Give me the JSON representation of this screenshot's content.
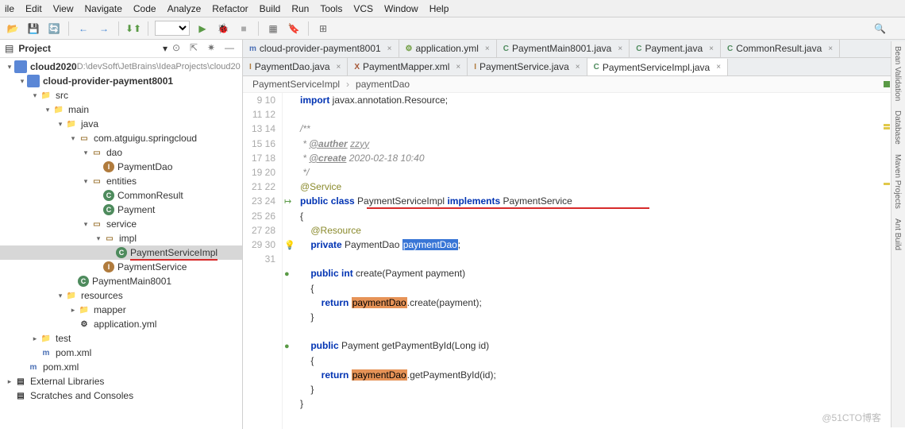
{
  "menu": [
    "ile",
    "Edit",
    "View",
    "Navigate",
    "Code",
    "Analyze",
    "Refactor",
    "Build",
    "Run",
    "Tools",
    "VCS",
    "Window",
    "Help"
  ],
  "project_tool": {
    "title": "Project"
  },
  "tree": [
    {
      "depth": 0,
      "arrow": "▾",
      "iconType": "module",
      "iconChar": "",
      "label": "cloud2020",
      "bold": true,
      "suffix": " D:\\devSoft\\JetBrains\\IdeaProjects\\cloud20"
    },
    {
      "depth": 1,
      "arrow": "▾",
      "iconType": "module",
      "iconChar": "",
      "label": "cloud-provider-payment8001",
      "bold": true
    },
    {
      "depth": 2,
      "arrow": "▾",
      "iconType": "folder",
      "iconChar": "📁",
      "label": "src"
    },
    {
      "depth": 3,
      "arrow": "▾",
      "iconType": "folder",
      "iconChar": "📁",
      "label": "main"
    },
    {
      "depth": 4,
      "arrow": "▾",
      "iconType": "folder",
      "iconChar": "📁",
      "label": "java"
    },
    {
      "depth": 5,
      "arrow": "▾",
      "iconType": "pkg",
      "iconChar": "▭",
      "label": "com.atguigu.springcloud"
    },
    {
      "depth": 6,
      "arrow": "▾",
      "iconType": "pkg",
      "iconChar": "▭",
      "label": "dao"
    },
    {
      "depth": 7,
      "arrow": "",
      "iconType": "class-i",
      "iconChar": "I",
      "label": "PaymentDao"
    },
    {
      "depth": 6,
      "arrow": "▾",
      "iconType": "pkg",
      "iconChar": "▭",
      "label": "entities"
    },
    {
      "depth": 7,
      "arrow": "",
      "iconType": "class-c",
      "iconChar": "C",
      "label": "CommonResult"
    },
    {
      "depth": 7,
      "arrow": "",
      "iconType": "class-c",
      "iconChar": "C",
      "label": "Payment"
    },
    {
      "depth": 6,
      "arrow": "▾",
      "iconType": "pkg",
      "iconChar": "▭",
      "label": "service"
    },
    {
      "depth": 7,
      "arrow": "▾",
      "iconType": "pkg",
      "iconChar": "▭",
      "label": "impl"
    },
    {
      "depth": 8,
      "arrow": "",
      "iconType": "class-c",
      "iconChar": "C",
      "label": "PaymentServiceImpl",
      "selected": true,
      "redUnder": true
    },
    {
      "depth": 7,
      "arrow": "",
      "iconType": "class-i",
      "iconChar": "I",
      "label": "PaymentService"
    },
    {
      "depth": 5,
      "arrow": "",
      "iconType": "class-c",
      "iconChar": "C",
      "label": "PaymentMain8001"
    },
    {
      "depth": 4,
      "arrow": "▾",
      "iconType": "folder",
      "iconChar": "📁",
      "label": "resources"
    },
    {
      "depth": 5,
      "arrow": "▸",
      "iconType": "folder",
      "iconChar": "📁",
      "label": "mapper"
    },
    {
      "depth": 5,
      "arrow": "",
      "iconType": "file",
      "iconChar": "⚙",
      "label": "application.yml"
    },
    {
      "depth": 2,
      "arrow": "▸",
      "iconType": "folder",
      "iconChar": "📁",
      "label": "test"
    },
    {
      "depth": 2,
      "arrow": "",
      "iconType": "maven",
      "iconChar": "m",
      "label": "pom.xml"
    },
    {
      "depth": 1,
      "arrow": "",
      "iconType": "maven",
      "iconChar": "m",
      "label": "pom.xml"
    },
    {
      "depth": 0,
      "arrow": "▸",
      "iconType": "lib",
      "iconChar": "▤",
      "label": "External Libraries"
    },
    {
      "depth": 0,
      "arrow": "",
      "iconType": "scratch",
      "iconChar": "▤",
      "label": "Scratches and Consoles"
    }
  ],
  "tabs_row1": [
    {
      "label": "cloud-provider-payment8001",
      "icon": "m",
      "color": "#4a6fb5"
    },
    {
      "label": "application.yml",
      "icon": "⚙",
      "color": "#6a9a3a"
    },
    {
      "label": "PaymentMain8001.java",
      "icon": "C",
      "color": "#4e8b5d"
    },
    {
      "label": "Payment.java",
      "icon": "C",
      "color": "#4e8b5d"
    },
    {
      "label": "CommonResult.java",
      "icon": "C",
      "color": "#4e8b5d"
    }
  ],
  "tabs_row2": [
    {
      "label": "PaymentDao.java",
      "icon": "I",
      "color": "#b07b3d"
    },
    {
      "label": "PaymentMapper.xml",
      "icon": "X",
      "color": "#a55636"
    },
    {
      "label": "PaymentService.java",
      "icon": "I",
      "color": "#b07b3d"
    },
    {
      "label": "PaymentServiceImpl.java",
      "icon": "C",
      "color": "#4e8b5d",
      "active": true
    }
  ],
  "breadcrumb": [
    "PaymentServiceImpl",
    "paymentDao"
  ],
  "code": {
    "lines": [
      {
        "n": 9,
        "html": "<span class='kw'>import</span> javax.annotation.Resource;"
      },
      {
        "n": 10,
        "html": ""
      },
      {
        "n": 11,
        "html": "<span class='cmt'>/**</span>"
      },
      {
        "n": 12,
        "html": "<span class='cmt'> * </span><span class='doc-tag'>@auther</span><span class='cmt'> </span><span class='cmt' style='text-decoration:underline'>zzyy</span>"
      },
      {
        "n": 13,
        "html": "<span class='cmt'> * </span><span class='doc-tag'>@create</span><span class='cmt'> 2020-02-18 10:40</span>"
      },
      {
        "n": 14,
        "html": "<span class='cmt'> */</span>"
      },
      {
        "n": 15,
        "html": "<span class='ann'>@Service</span>"
      },
      {
        "n": 16,
        "html": "<span class='kw'>public</span> <span class='kw'>class</span> PaymentServiceImpl <span class='kw'>implements</span> PaymentService"
      },
      {
        "n": 17,
        "html": "{"
      },
      {
        "n": 18,
        "html": "    <span class='ann'>@Resource</span>"
      },
      {
        "n": 19,
        "hl": true,
        "html": "    <span class='kw'>private</span> PaymentDao <span class='hl-box'>paymentDao</span>;"
      },
      {
        "n": 20,
        "html": ""
      },
      {
        "n": 21,
        "html": "    <span class='kw'>public</span> <span class='kw'>int</span> create(Payment payment)"
      },
      {
        "n": 22,
        "html": "    {"
      },
      {
        "n": 23,
        "html": "        <span class='kw'>return</span> <span class='hl-orange'>paymentDao</span>.create(payment);"
      },
      {
        "n": 24,
        "html": "    }"
      },
      {
        "n": 25,
        "html": ""
      },
      {
        "n": 26,
        "html": "    <span class='kw'>public</span> Payment getPaymentById(Long id)"
      },
      {
        "n": 27,
        "html": "    {"
      },
      {
        "n": 28,
        "html": "        <span class='kw'>return</span> <span class='hl-orange'>paymentDao</span>.getPaymentById(id);"
      },
      {
        "n": 29,
        "html": "    }"
      },
      {
        "n": 30,
        "html": "}"
      },
      {
        "n": 31,
        "html": ""
      }
    ]
  },
  "side_tools": [
    "Bean Validation",
    "Database",
    "Maven Projects",
    "Ant Build"
  ],
  "watermark": "@51CTO博客"
}
